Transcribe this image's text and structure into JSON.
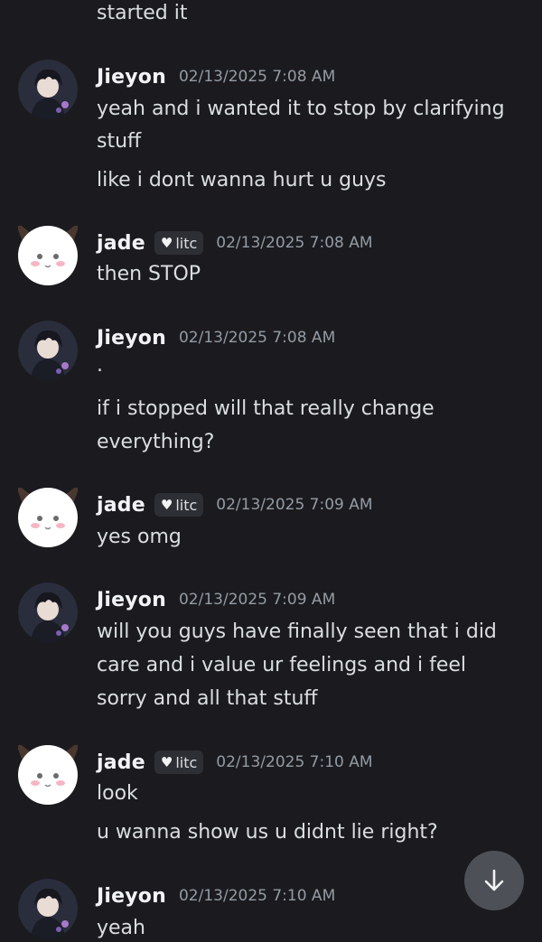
{
  "chat": {
    "top_line": "started it",
    "messages": [
      {
        "author": "Jieyon",
        "timestamp": "02/13/2025 7:08 AM",
        "lines": [
          "yeah and i wanted it to stop by clarifying",
          "stuff",
          "like i dont wanna hurt u guys"
        ]
      },
      {
        "author": "jade",
        "tag": "litc",
        "timestamp": "02/13/2025 7:08 AM",
        "lines": [
          "then STOP"
        ]
      },
      {
        "author": "Jieyon",
        "timestamp": "02/13/2025 7:08 AM",
        "lines": [
          ".",
          "if i stopped will that really change",
          "everything?"
        ]
      },
      {
        "author": "jade",
        "tag": "litc",
        "timestamp": "02/13/2025 7:09 AM",
        "lines": [
          "yes omg"
        ]
      },
      {
        "author": "Jieyon",
        "timestamp": "02/13/2025 7:09 AM",
        "lines": [
          "will you guys have finally seen that i did",
          "care and i value ur feelings and i feel",
          "sorry and all that stuff"
        ]
      },
      {
        "author": "jade",
        "tag": "litc",
        "timestamp": "02/13/2025 7:10 AM",
        "lines": [
          "look",
          "u wanna show us u didnt lie right?"
        ]
      },
      {
        "author": "Jieyon",
        "timestamp": "02/13/2025 7:10 AM",
        "lines": [
          "yeah"
        ]
      }
    ]
  },
  "icons": {
    "scroll_down": "arrow-down-icon",
    "tag_heart": "heart-icon"
  },
  "colors": {
    "background": "#1b1b1f",
    "username": "#f2f3f5",
    "message_text": "#dbdee1",
    "timestamp": "#949ba4",
    "tag_background": "#2e2f35",
    "scroll_button": "#4e5058"
  }
}
